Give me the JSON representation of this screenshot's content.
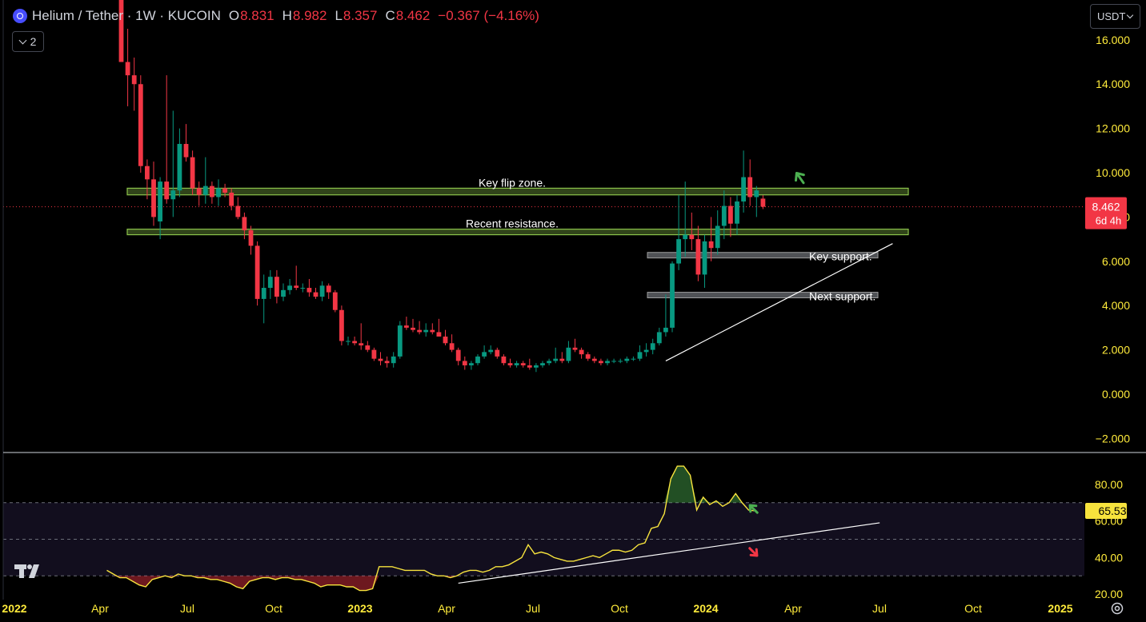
{
  "legend": {
    "symbol": "Helium / Tether · 1W · KUCOIN",
    "o_label": "O",
    "o_value": "8.831",
    "h_label": "H",
    "h_value": "8.982",
    "l_label": "L",
    "l_value": "8.357",
    "c_label": "C",
    "c_value": "8.462",
    "change": "−0.367 (−4.16%)",
    "collapse_count": "2"
  },
  "currency": "USDT",
  "colors": {
    "up": "#089981",
    "down": "#f23645",
    "axis_text": "#ffeb3b",
    "zone": "#8bc34a",
    "support": "#b2b5be",
    "rsi": "#f7e33d"
  },
  "chart_data": [
    {
      "type": "candlestick",
      "title": "Helium / Tether · 1W · KUCOIN",
      "ylim": [
        -2.6,
        17.8
      ],
      "y_ticks": [
        "16.000",
        "14.000",
        "12.000",
        "10.000",
        "8.000",
        "6.000",
        "4.000",
        "2.000",
        "0.000",
        "−2.000"
      ],
      "x_ticks": [
        "2022",
        "Apr",
        "Jul",
        "Oct",
        "2023",
        "Apr",
        "Jul",
        "Oct",
        "2024",
        "Apr",
        "Jul",
        "Oct",
        "2025"
      ],
      "last_price": "8.462",
      "countdown": "6d 4h",
      "candles": [
        {
          "o": 18.5,
          "h": 19.5,
          "l": 15.5,
          "c": 15.0
        },
        {
          "o": 15.0,
          "h": 16.5,
          "l": 13.0,
          "c": 14.4
        },
        {
          "o": 14.4,
          "h": 15.2,
          "l": 12.8,
          "c": 14.0
        },
        {
          "o": 14.0,
          "h": 14.4,
          "l": 10.0,
          "c": 10.3
        },
        {
          "o": 10.3,
          "h": 10.6,
          "l": 8.8,
          "c": 9.7
        },
        {
          "o": 9.7,
          "h": 10.5,
          "l": 7.6,
          "c": 8.0
        },
        {
          "o": 7.8,
          "h": 9.8,
          "l": 7.0,
          "c": 9.6
        },
        {
          "o": 9.6,
          "h": 14.4,
          "l": 8.6,
          "c": 8.8
        },
        {
          "o": 8.8,
          "h": 12.8,
          "l": 8.0,
          "c": 9.2
        },
        {
          "o": 9.2,
          "h": 12.0,
          "l": 8.9,
          "c": 11.3
        },
        {
          "o": 11.3,
          "h": 12.2,
          "l": 10.5,
          "c": 10.7
        },
        {
          "o": 10.7,
          "h": 11.0,
          "l": 9.0,
          "c": 9.3
        },
        {
          "o": 9.3,
          "h": 9.6,
          "l": 8.5,
          "c": 9.0
        },
        {
          "o": 9.0,
          "h": 10.7,
          "l": 8.6,
          "c": 9.4
        },
        {
          "o": 9.4,
          "h": 9.6,
          "l": 8.6,
          "c": 8.9
        },
        {
          "o": 8.9,
          "h": 9.7,
          "l": 8.5,
          "c": 9.3
        },
        {
          "o": 9.3,
          "h": 9.5,
          "l": 8.9,
          "c": 9.1
        },
        {
          "o": 9.1,
          "h": 9.3,
          "l": 8.3,
          "c": 8.5
        },
        {
          "o": 8.5,
          "h": 8.9,
          "l": 7.9,
          "c": 8.0
        },
        {
          "o": 8.0,
          "h": 8.2,
          "l": 7.0,
          "c": 7.4
        },
        {
          "o": 7.4,
          "h": 7.6,
          "l": 6.3,
          "c": 6.7
        },
        {
          "o": 6.7,
          "h": 6.9,
          "l": 4.0,
          "c": 4.3
        },
        {
          "o": 4.3,
          "h": 5.4,
          "l": 3.2,
          "c": 4.8
        },
        {
          "o": 4.8,
          "h": 5.6,
          "l": 4.3,
          "c": 5.3
        },
        {
          "o": 5.3,
          "h": 5.6,
          "l": 4.1,
          "c": 4.4
        },
        {
          "o": 4.4,
          "h": 5.0,
          "l": 4.2,
          "c": 4.7
        },
        {
          "o": 4.7,
          "h": 5.2,
          "l": 4.5,
          "c": 4.9
        },
        {
          "o": 4.9,
          "h": 5.8,
          "l": 4.7,
          "c": 4.8
        },
        {
          "o": 4.8,
          "h": 5.0,
          "l": 4.6,
          "c": 4.8
        },
        {
          "o": 4.8,
          "h": 5.2,
          "l": 4.4,
          "c": 4.6
        },
        {
          "o": 4.6,
          "h": 4.8,
          "l": 4.3,
          "c": 4.4
        },
        {
          "o": 4.4,
          "h": 5.1,
          "l": 4.2,
          "c": 4.9
        },
        {
          "o": 4.9,
          "h": 5.0,
          "l": 4.3,
          "c": 4.6
        },
        {
          "o": 4.6,
          "h": 4.7,
          "l": 3.7,
          "c": 3.8
        },
        {
          "o": 3.8,
          "h": 4.0,
          "l": 2.2,
          "c": 2.4
        },
        {
          "o": 2.4,
          "h": 2.6,
          "l": 2.2,
          "c": 2.4
        },
        {
          "o": 2.4,
          "h": 2.6,
          "l": 2.2,
          "c": 2.3
        },
        {
          "o": 2.3,
          "h": 3.2,
          "l": 2.0,
          "c": 2.2
        },
        {
          "o": 2.2,
          "h": 2.4,
          "l": 1.9,
          "c": 2.0
        },
        {
          "o": 2.0,
          "h": 2.1,
          "l": 1.5,
          "c": 1.6
        },
        {
          "o": 1.6,
          "h": 1.9,
          "l": 1.3,
          "c": 1.5
        },
        {
          "o": 1.5,
          "h": 1.7,
          "l": 1.2,
          "c": 1.4
        },
        {
          "o": 1.4,
          "h": 1.9,
          "l": 1.2,
          "c": 1.7
        },
        {
          "o": 1.7,
          "h": 3.3,
          "l": 1.6,
          "c": 3.1
        },
        {
          "o": 3.1,
          "h": 3.5,
          "l": 2.9,
          "c": 3.0
        },
        {
          "o": 3.0,
          "h": 3.4,
          "l": 2.8,
          "c": 2.9
        },
        {
          "o": 2.9,
          "h": 3.3,
          "l": 2.7,
          "c": 2.8
        },
        {
          "o": 2.8,
          "h": 3.2,
          "l": 2.6,
          "c": 2.9
        },
        {
          "o": 2.9,
          "h": 3.2,
          "l": 2.7,
          "c": 2.8
        },
        {
          "o": 2.8,
          "h": 3.4,
          "l": 2.7,
          "c": 2.6
        },
        {
          "o": 2.6,
          "h": 2.9,
          "l": 2.2,
          "c": 2.3
        },
        {
          "o": 2.3,
          "h": 2.7,
          "l": 1.9,
          "c": 2.0
        },
        {
          "o": 2.0,
          "h": 2.1,
          "l": 1.3,
          "c": 1.5
        },
        {
          "o": 1.5,
          "h": 1.7,
          "l": 1.1,
          "c": 1.3
        },
        {
          "o": 1.3,
          "h": 1.5,
          "l": 1.1,
          "c": 1.4
        },
        {
          "o": 1.4,
          "h": 1.8,
          "l": 1.3,
          "c": 1.7
        },
        {
          "o": 1.7,
          "h": 2.2,
          "l": 1.6,
          "c": 1.9
        },
        {
          "o": 1.9,
          "h": 2.2,
          "l": 1.8,
          "c": 2.0
        },
        {
          "o": 2.0,
          "h": 2.1,
          "l": 1.6,
          "c": 1.7
        },
        {
          "o": 1.7,
          "h": 1.8,
          "l": 1.3,
          "c": 1.4
        },
        {
          "o": 1.4,
          "h": 1.6,
          "l": 1.2,
          "c": 1.3
        },
        {
          "o": 1.3,
          "h": 1.5,
          "l": 1.2,
          "c": 1.4
        },
        {
          "o": 1.4,
          "h": 1.5,
          "l": 1.2,
          "c": 1.3
        },
        {
          "o": 1.3,
          "h": 1.6,
          "l": 1.1,
          "c": 1.2
        },
        {
          "o": 1.2,
          "h": 1.4,
          "l": 1.0,
          "c": 1.3
        },
        {
          "o": 1.3,
          "h": 1.5,
          "l": 1.2,
          "c": 1.4
        },
        {
          "o": 1.4,
          "h": 1.6,
          "l": 1.3,
          "c": 1.5
        },
        {
          "o": 1.5,
          "h": 2.1,
          "l": 1.4,
          "c": 1.6
        },
        {
          "o": 1.6,
          "h": 1.9,
          "l": 1.4,
          "c": 1.5
        },
        {
          "o": 1.5,
          "h": 2.4,
          "l": 1.4,
          "c": 2.1
        },
        {
          "o": 2.1,
          "h": 2.5,
          "l": 1.9,
          "c": 2.0
        },
        {
          "o": 2.0,
          "h": 2.1,
          "l": 1.6,
          "c": 1.8
        },
        {
          "o": 1.8,
          "h": 1.9,
          "l": 1.5,
          "c": 1.6
        },
        {
          "o": 1.6,
          "h": 1.7,
          "l": 1.4,
          "c": 1.5
        },
        {
          "o": 1.5,
          "h": 1.6,
          "l": 1.3,
          "c": 1.4
        },
        {
          "o": 1.4,
          "h": 1.6,
          "l": 1.3,
          "c": 1.5
        },
        {
          "o": 1.5,
          "h": 1.6,
          "l": 1.4,
          "c": 1.5
        },
        {
          "o": 1.5,
          "h": 1.6,
          "l": 1.4,
          "c": 1.5
        },
        {
          "o": 1.5,
          "h": 1.7,
          "l": 1.4,
          "c": 1.6
        },
        {
          "o": 1.6,
          "h": 1.7,
          "l": 1.5,
          "c": 1.6
        },
        {
          "o": 1.6,
          "h": 2.2,
          "l": 1.5,
          "c": 1.9
        },
        {
          "o": 1.9,
          "h": 2.3,
          "l": 1.7,
          "c": 2.0
        },
        {
          "o": 2.0,
          "h": 2.5,
          "l": 1.8,
          "c": 2.3
        },
        {
          "o": 2.3,
          "h": 3.0,
          "l": 2.2,
          "c": 2.8
        },
        {
          "o": 2.8,
          "h": 4.5,
          "l": 2.6,
          "c": 3.0
        },
        {
          "o": 3.0,
          "h": 6.0,
          "l": 2.8,
          "c": 5.9
        },
        {
          "o": 5.9,
          "h": 9.0,
          "l": 5.6,
          "c": 7.0
        },
        {
          "o": 7.0,
          "h": 9.6,
          "l": 6.2,
          "c": 7.2
        },
        {
          "o": 7.2,
          "h": 8.2,
          "l": 6.5,
          "c": 7.0
        },
        {
          "o": 7.0,
          "h": 7.6,
          "l": 5.1,
          "c": 5.4
        },
        {
          "o": 5.4,
          "h": 7.2,
          "l": 4.8,
          "c": 6.9
        },
        {
          "o": 6.9,
          "h": 8.0,
          "l": 6.0,
          "c": 6.6
        },
        {
          "o": 6.6,
          "h": 8.3,
          "l": 6.3,
          "c": 7.6
        },
        {
          "o": 7.6,
          "h": 9.2,
          "l": 7.0,
          "c": 8.5
        },
        {
          "o": 8.5,
          "h": 8.9,
          "l": 7.1,
          "c": 7.7
        },
        {
          "o": 7.7,
          "h": 9.0,
          "l": 7.2,
          "c": 8.7
        },
        {
          "o": 8.7,
          "h": 11.0,
          "l": 8.2,
          "c": 9.8
        },
        {
          "o": 9.8,
          "h": 10.6,
          "l": 8.5,
          "c": 8.9
        },
        {
          "o": 8.9,
          "h": 9.4,
          "l": 8.0,
          "c": 9.2
        },
        {
          "o": 8.831,
          "h": 8.982,
          "l": 8.357,
          "c": 8.462
        }
      ],
      "zones": [
        {
          "label": "Key flip zone.",
          "y_low": 9.0,
          "y_high": 9.3
        },
        {
          "label": "Recent resistance.",
          "y_low": 7.2,
          "y_high": 7.45
        }
      ],
      "supports": [
        {
          "label": "Key support.",
          "y_low": 6.15,
          "y_high": 6.4
        },
        {
          "label": "Next support.",
          "y_low": 4.35,
          "y_high": 4.6
        }
      ],
      "trendline": {
        "from": [
          84,
          1.5
        ],
        "to": [
          119,
          6.8
        ]
      }
    },
    {
      "type": "line",
      "ylim": [
        17.0,
        97.0
      ],
      "y_ticks": [
        "80.00",
        "60.00",
        "40.00",
        "20.00"
      ],
      "last_value": "65.53",
      "band": {
        "upper": 70,
        "mid": 50,
        "lower": 30
      },
      "values": [
        33,
        31,
        29,
        29,
        27,
        25,
        24,
        28,
        29,
        30,
        29,
        31,
        30,
        30,
        29,
        29,
        28,
        28,
        27,
        26,
        24,
        23,
        27,
        28,
        29,
        29,
        28,
        29,
        29,
        28,
        28,
        27,
        26,
        24,
        25,
        25,
        25,
        24,
        24,
        22,
        22,
        23,
        35,
        35,
        35,
        34,
        33,
        33,
        33,
        33,
        31,
        30,
        30,
        29,
        30,
        32,
        33,
        33,
        32,
        33,
        35,
        35,
        36,
        38,
        40,
        47,
        42,
        43,
        42,
        40,
        39,
        38,
        38,
        39,
        40,
        41,
        40,
        42,
        44,
        44,
        43,
        44,
        47,
        48,
        56,
        57,
        64,
        83,
        90,
        90,
        85,
        66,
        73,
        69,
        71,
        68,
        70,
        75,
        70,
        66,
        65.53
      ],
      "trendline": {
        "from": [
          52,
          26
        ],
        "to": [
          117,
          59
        ]
      }
    }
  ]
}
